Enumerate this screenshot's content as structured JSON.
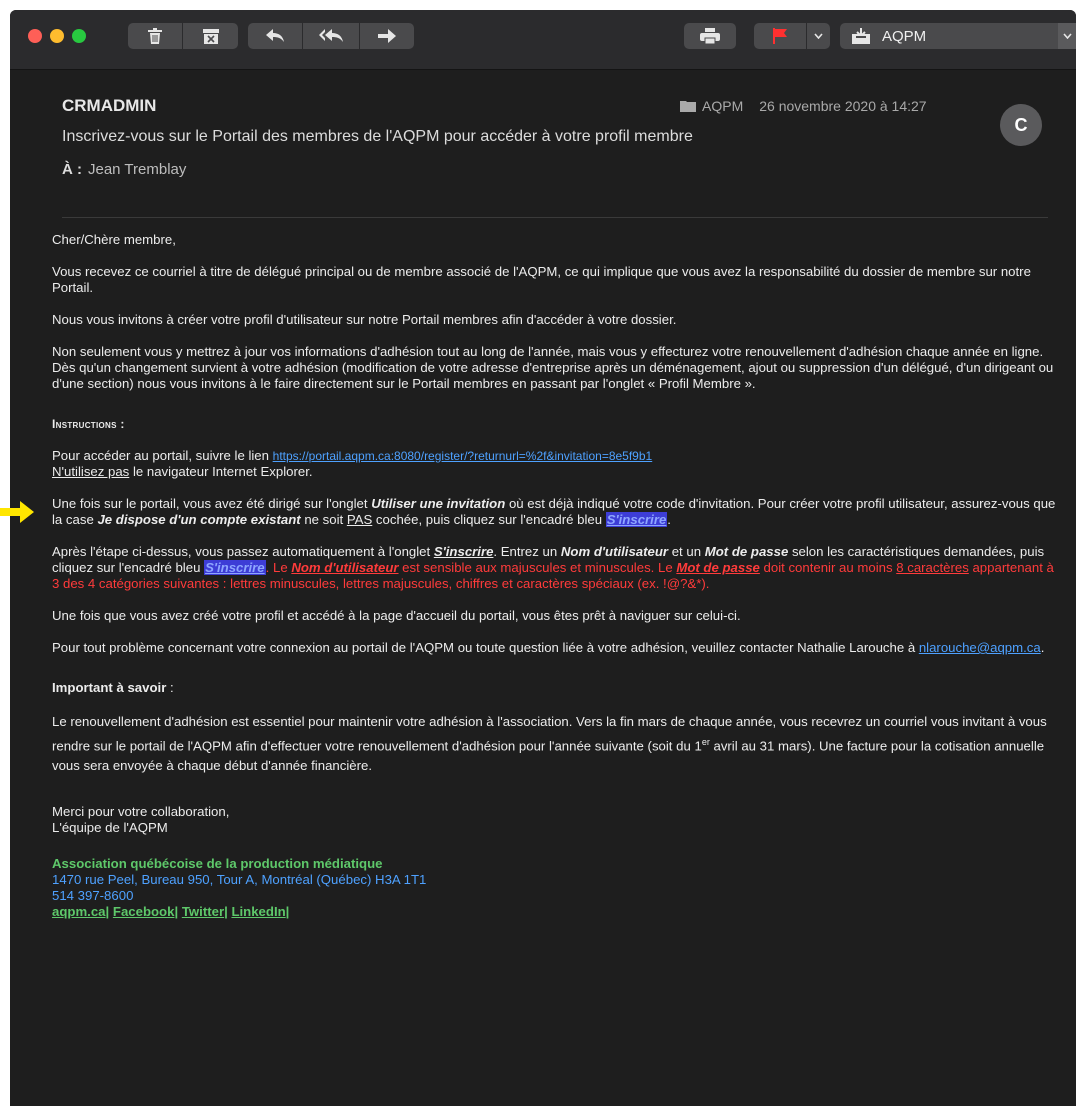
{
  "window": {
    "mailbox": "AQPM",
    "toolbar_icons": [
      "trash-icon",
      "archive-icon",
      "reply-icon",
      "reply-all-icon",
      "forward-icon",
      "print-icon",
      "flag-icon",
      "move-to-mailbox-icon"
    ]
  },
  "header": {
    "from": "CRMADMIN",
    "subject": "Inscrivez-vous sur le Portail des membres de l'AQPM pour accéder à votre profil membre",
    "to_label": "À :",
    "to": "Jean Tremblay",
    "folder": "AQPM",
    "date": "26 novembre 2020 à 14:27",
    "avatar": "C"
  },
  "body": {
    "greeting": "Cher/Chère membre,",
    "p1": "Vous recevez ce courriel à titre de délégué principal ou de membre associé de l'AQPM, ce qui implique que vous avez la responsabilité du dossier de membre sur notre Portail.",
    "p2": "Nous vous invitons à créer votre profil d'utilisateur sur notre Portail membres afin d'accéder à votre dossier.",
    "p3": "Non seulement vous y mettrez à jour vos informations d'adhésion tout au long de l'année, mais vous y effecturez votre renouvellement d'adhésion chaque année en ligne. Dès qu'un changement survient à votre adhésion (modification de votre adresse d'entreprise après un déménagement, ajout ou suppression d'un délégué, d'un dirigeant ou d'une section) nous vous invitons à le faire directement sur le Portail membres en passant par l'onglet « Profil Membre ».",
    "instructions_heading": "Instructions :",
    "access_text": "Pour accéder au portail, suivre le lien ",
    "access_link": "https://portail.aqpm.ca:8080/register/?returnurl=%2f&invitation=8e5f9b1",
    "ie_no": "N'utilisez pas",
    "ie_rest": " le navigateur Internet Explorer.",
    "s1_a": "Une fois sur le portail, vous avez été dirigé sur l'onglet ",
    "s1_b": "Utiliser une invitation",
    "s1_c": " où est déjà indiqué votre code d'invitation. Pour créer votre profil utilisateur, assurez-vous que la case ",
    "s1_d": "Je dispose d'un compte existant",
    "s1_e": " ne soit ",
    "s1_f": "PAS",
    "s1_g": " cochée, puis cliquez sur l'encadré bleu ",
    "s1_h": "S'inscrire",
    "s1_i": ".",
    "s2_a": "Après l'étape ci-dessus, vous passez automatiquement à l'onglet ",
    "s2_b": "S'inscrire",
    "s2_c": ". Entrez un ",
    "s2_d": "Nom d'utilisateur",
    "s2_e": " et un ",
    "s2_f": "Mot de passe",
    "s2_g": " selon les caractéristiques demandées, puis cliquez sur l'encadré bleu ",
    "s2_h": "S'inscrire",
    "s2_i": ". Le ",
    "s2_j": "Nom d'utilisateur",
    "s2_k": " est sensible aux majuscules et minuscules. Le ",
    "s2_l": "Mot de passe",
    "s2_m": " doit contenir au moins ",
    "s2_n": "8 caractères",
    "s2_o": " appartenant à 3 des 4 catégories suivantes : lettres minuscules, lettres majuscules, chiffres et caractères spéciaux (ex. !@?&*).",
    "p4": "Une fois que vous avez créé votre profil et accédé à la page d'accueil du portail, vous êtes prêt à naviguer sur celui-ci.",
    "p5_a": "Pour tout problème concernant votre connexion au portail de l'AQPM ou toute question liée à votre adhésion, veuillez contacter Nathalie Larouche à ",
    "p5_email": "nlarouche@aqpm.ca",
    "p5_b": ".",
    "important_heading": "Important à savoir",
    "important_colon": " :",
    "p6_a": "Le renouvellement d'adhésion est essentiel pour maintenir votre adhésion à l'association. Vers la fin mars de chaque année, vous recevrez un courriel vous invitant à vous rendre sur le portail de l'AQPM afin d'effectuer votre renouvellement d'adhésion pour l'année suivante (soit du 1",
    "p6_sup": "er",
    "p6_b": " avril au 31 mars). Une facture pour la cotisation annuelle vous sera envoyée à chaque début d'année financière.",
    "thanks": "Merci pour votre collaboration,",
    "team": "L'équipe de l'AQPM",
    "sig_org": "Association québécoise de la production médiatique",
    "sig_address": "1470 rue Peel, Bureau 950, Tour A, Montréal (Québec)  H3A 1T1",
    "sig_phone": "514 397-8600",
    "sig_links": [
      "aqpm.ca",
      "Facebook",
      "Twitter",
      "LinkedIn"
    ],
    "sig_sep": "|"
  },
  "colors": {
    "background": "#1e1e1e",
    "toolbar": "#2b2b2d",
    "link": "#4ea1ff",
    "red": "#ff3b3b",
    "green": "#5ec86a",
    "button_blue": "#3d3dd6",
    "annotation_arrow": "#ffe600"
  }
}
